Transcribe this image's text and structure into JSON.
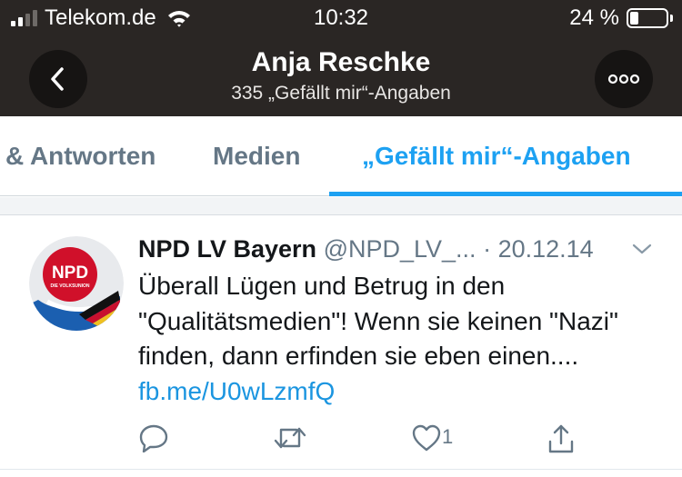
{
  "status_bar": {
    "carrier": "Telekom.de",
    "time": "10:32",
    "battery": "24 %",
    "battery_level": 0.24,
    "signal_bars": 2
  },
  "nav": {
    "title": "Anja Reschke",
    "subtitle": "335 „Gefällt mir“-Angaben",
    "back_icon": "chevron-left-icon",
    "more_icon": "more-icon"
  },
  "tabs": [
    {
      "label": "& Antworten",
      "active": false
    },
    {
      "label": "Medien",
      "active": false
    },
    {
      "label": "„Gefällt mir“-Angaben",
      "active": true
    }
  ],
  "tweet": {
    "name": "NPD LV Bayern",
    "handle": "@NPD_LV_...",
    "date": "· 20.12.14",
    "text": "Überall Lügen und Betrug in den \"Qualitätsmedien\"! Wenn sie keinen \"Nazi\" finden, dann erfinden sie eben einen.... ",
    "link": "fb.me/U0wLzmfQ",
    "avatar_label": "NPD",
    "avatar_sublabel": "DIE VOLKSUNION",
    "like_count": "1"
  },
  "colors": {
    "header_bg": "#2a2624",
    "accent": "#1da1f2",
    "link": "#1b95e0",
    "muted": "#657786"
  }
}
